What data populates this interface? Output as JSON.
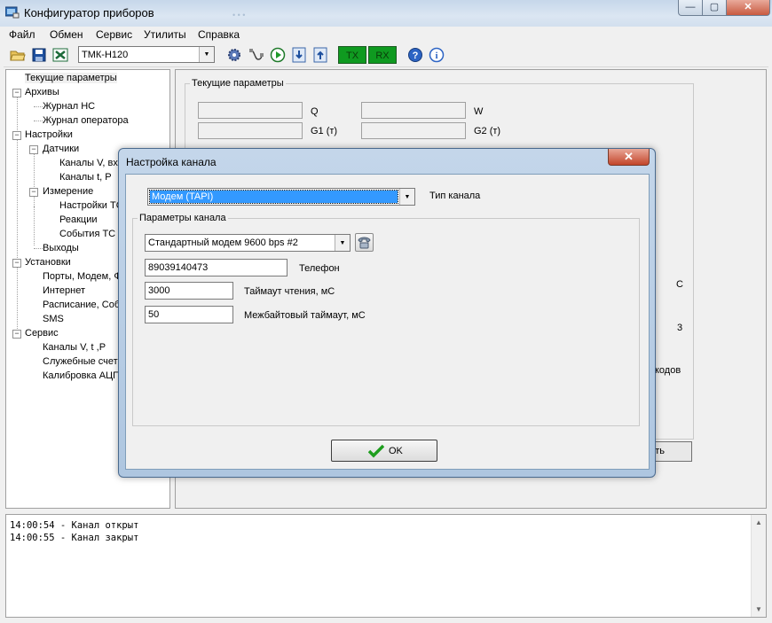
{
  "window": {
    "title": "Конфигуратор приборов",
    "minimize_glyph": "—",
    "maximize_glyph": "▢",
    "close_glyph": "✕"
  },
  "menu": [
    "Файл",
    "Обмен",
    "Сервис",
    "Утилиты",
    "Справка"
  ],
  "toolbar": {
    "device": "ТМК-Н120",
    "tx_label": "TX",
    "rx_label": "RX"
  },
  "tree": {
    "items": [
      "Текущие параметры",
      "Архивы",
      "Журнал НС",
      "Журнал оператора",
      "Настройки",
      "Датчики",
      "Каналы V, вх",
      "Каналы t, P",
      "Измерение",
      "Настройки ТС",
      "Реакции",
      "События ТС",
      "Выходы",
      "Установки",
      "Порты, Модем, Ф",
      "Интернет",
      "Расписание, Соб",
      "SMS",
      "Сервис",
      "Каналы V, t ,P",
      "Служебные счет",
      "Калибровка АЦП"
    ],
    "expanded_glyph": "−"
  },
  "main": {
    "group_title": "Текущие параметры",
    "labels": [
      "Q",
      "W",
      "G1 (т)",
      "G2 (т)"
    ],
    "partial_labels": [
      "С",
      "3",
      "кодов"
    ],
    "button_fragment": "ть"
  },
  "dialog": {
    "title": "Настройка канала",
    "close_glyph": "✕",
    "channel_type_value": "Модем (TAPI)",
    "channel_type_label": "Тип канала",
    "params_group_label": "Параметры канала",
    "modem_value": "Стандартный модем  9600 bps #2",
    "phone_value": "89039140473",
    "phone_label": "Телефон",
    "read_timeout_value": "3000",
    "read_timeout_label": "Таймаут чтения, мС",
    "byte_timeout_value": "50",
    "byte_timeout_label": "Межбайтовый таймаут, мС",
    "ok_label": "OK"
  },
  "log": [
    "14:00:54 - Канал открыт",
    "14:00:55 - Канал закрыт"
  ],
  "colors": {
    "tx_rx_bg": "#0f9a20",
    "selection": "#3399ff",
    "ok_check": "#1e9e1e"
  }
}
